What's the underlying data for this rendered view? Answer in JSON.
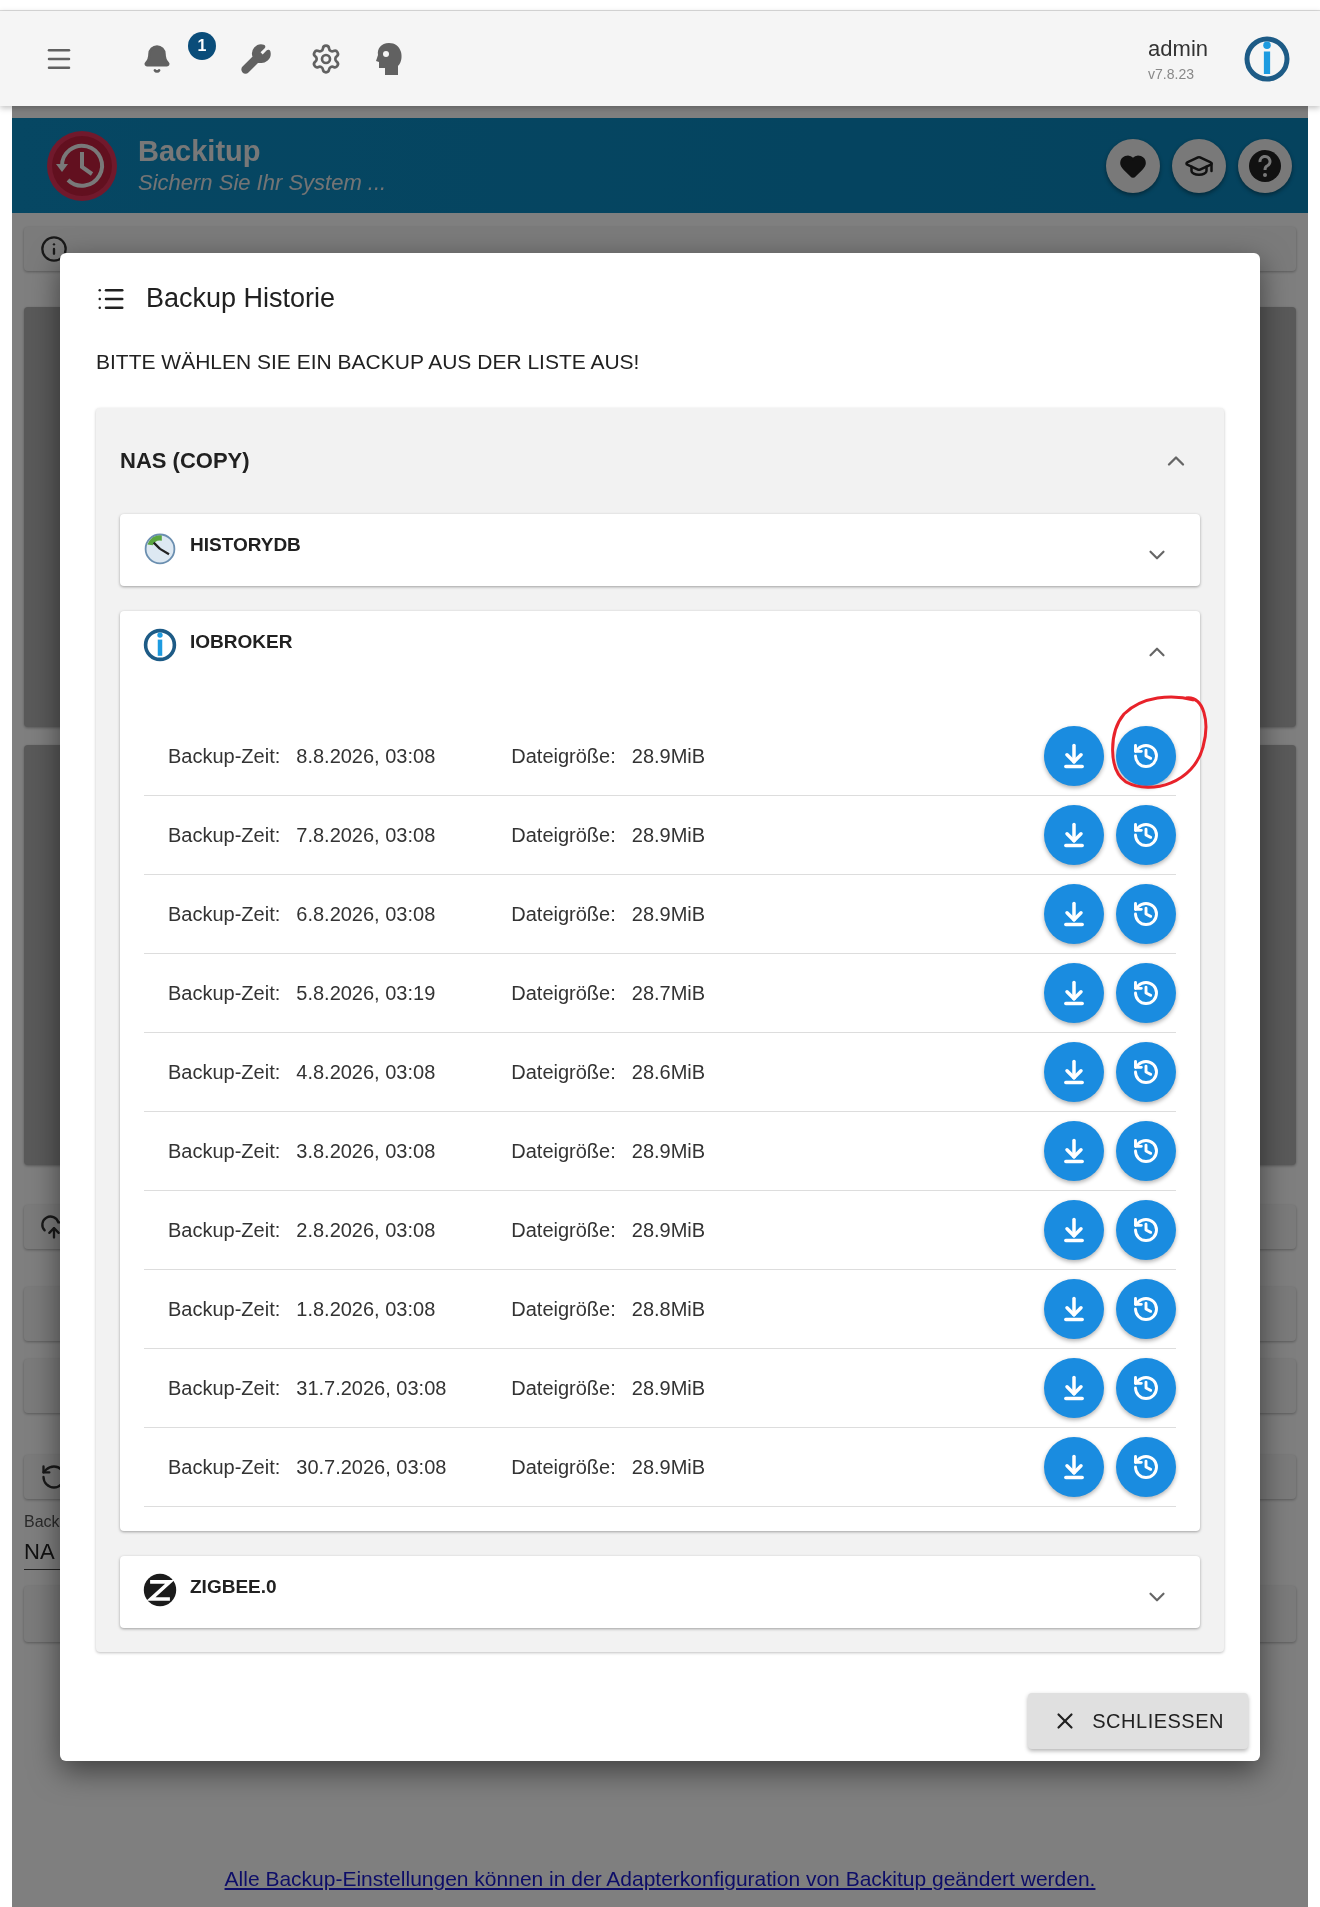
{
  "top_bar": {
    "notification_count": "1",
    "user": "admin",
    "version": "v7.8.23"
  },
  "adapter_header": {
    "title": "Backitup",
    "subtitle": "Sichern Sie Ihr System ..."
  },
  "background": {
    "field_label": "Back",
    "field_value": "NA"
  },
  "dialog": {
    "title": "Backup Historie",
    "instruction": "BITTE WÄHLEN SIE EIN BACKUP AUS DER LISTE AUS!",
    "storage": {
      "title": "NAS (COPY)",
      "expanded": true,
      "sections": [
        {
          "name": "HISTORYDB",
          "kind": "historydb",
          "expanded": false
        },
        {
          "name": "IOBROKER",
          "kind": "iobroker",
          "expanded": true,
          "rows": [
            {
              "time_label": "Backup-Zeit:",
              "time": "8.8.2026, 03:08",
              "size_label": "Dateigröße:",
              "size": "28.9MiB",
              "highlighted": true
            },
            {
              "time_label": "Backup-Zeit:",
              "time": "7.8.2026, 03:08",
              "size_label": "Dateigröße:",
              "size": "28.9MiB",
              "highlighted": false
            },
            {
              "time_label": "Backup-Zeit:",
              "time": "6.8.2026, 03:08",
              "size_label": "Dateigröße:",
              "size": "28.9MiB",
              "highlighted": false
            },
            {
              "time_label": "Backup-Zeit:",
              "time": "5.8.2026, 03:19",
              "size_label": "Dateigröße:",
              "size": "28.7MiB",
              "highlighted": false
            },
            {
              "time_label": "Backup-Zeit:",
              "time": "4.8.2026, 03:08",
              "size_label": "Dateigröße:",
              "size": "28.6MiB",
              "highlighted": false
            },
            {
              "time_label": "Backup-Zeit:",
              "time": "3.8.2026, 03:08",
              "size_label": "Dateigröße:",
              "size": "28.9MiB",
              "highlighted": false
            },
            {
              "time_label": "Backup-Zeit:",
              "time": "2.8.2026, 03:08",
              "size_label": "Dateigröße:",
              "size": "28.9MiB",
              "highlighted": false
            },
            {
              "time_label": "Backup-Zeit:",
              "time": "1.8.2026, 03:08",
              "size_label": "Dateigröße:",
              "size": "28.8MiB",
              "highlighted": false
            },
            {
              "time_label": "Backup-Zeit:",
              "time": "31.7.2026, 03:08",
              "size_label": "Dateigröße:",
              "size": "28.9MiB",
              "highlighted": false
            },
            {
              "time_label": "Backup-Zeit:",
              "time": "30.7.2026, 03:08",
              "size_label": "Dateigröße:",
              "size": "28.9MiB",
              "highlighted": false
            }
          ]
        },
        {
          "name": "ZIGBEE.0",
          "kind": "zigbee",
          "expanded": false
        }
      ]
    },
    "close_button": "SCHLIESSEN"
  },
  "footer_link": "Alle Backup-Einstellungen können in der Adapterkonfiguration von Backitup geändert werden."
}
